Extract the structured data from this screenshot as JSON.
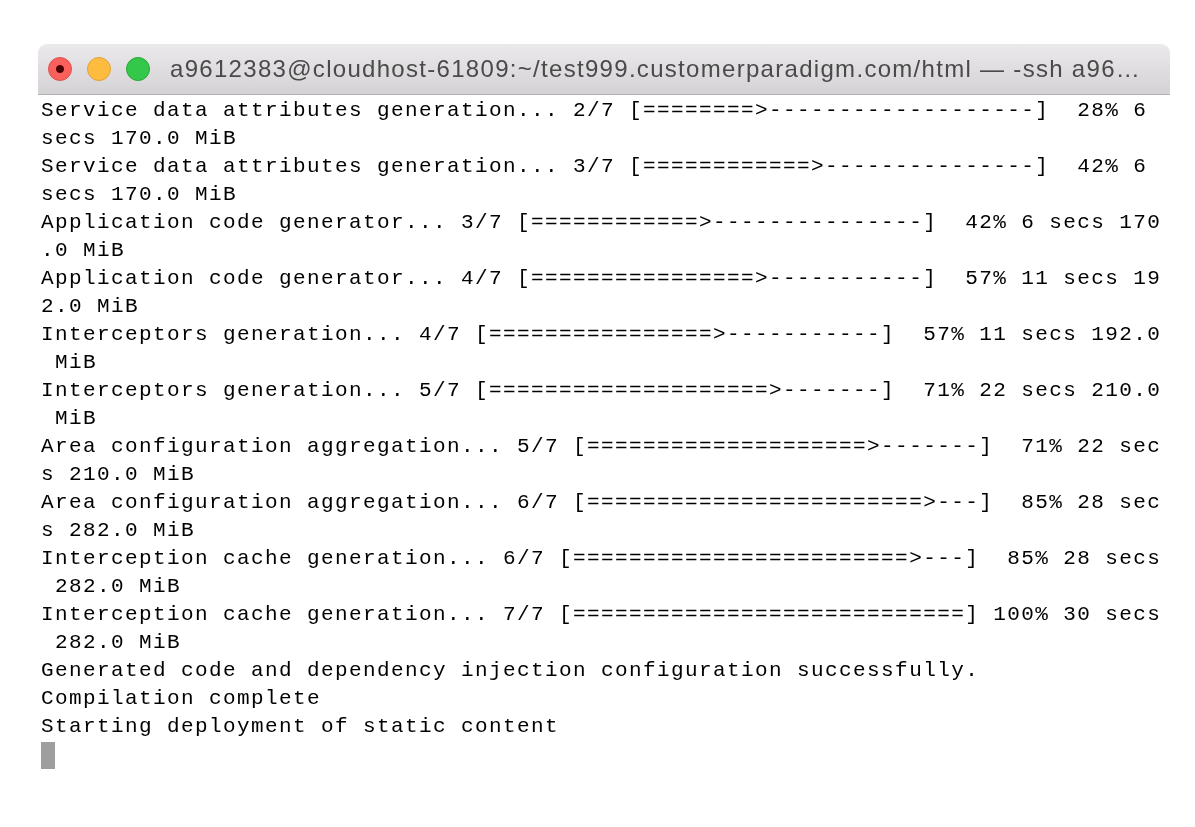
{
  "window": {
    "title": "a9612383@cloudhost-61809:~/test999.customerparadigm.com/html — -ssh a96…"
  },
  "terminal": {
    "lines": [
      "Service data attributes generation... 2/7 [========>-------------------]  28% 6",
      "secs 170.0 MiB",
      "Service data attributes generation... 3/7 [============>---------------]  42% 6",
      "secs 170.0 MiB",
      "Application code generator... 3/7 [============>---------------]  42% 6 secs 170",
      ".0 MiB",
      "Application code generator... 4/7 [================>-----------]  57% 11 secs 19",
      "2.0 MiB",
      "Interceptors generation... 4/7 [================>-----------]  57% 11 secs 192.0",
      " MiB",
      "Interceptors generation... 5/7 [====================>-------]  71% 22 secs 210.0",
      " MiB",
      "Area configuration aggregation... 5/7 [====================>-------]  71% 22 sec",
      "s 210.0 MiB",
      "Area configuration aggregation... 6/7 [========================>---]  85% 28 sec",
      "s 282.0 MiB",
      "Interception cache generation... 6/7 [========================>---]  85% 28 secs",
      " 282.0 MiB",
      "Interception cache generation... 7/7 [============================] 100% 30 secs",
      " 282.0 MiB",
      "Generated code and dependency injection configuration successfully.",
      "Compilation complete",
      "Starting deployment of static content"
    ],
    "cursor": true
  }
}
